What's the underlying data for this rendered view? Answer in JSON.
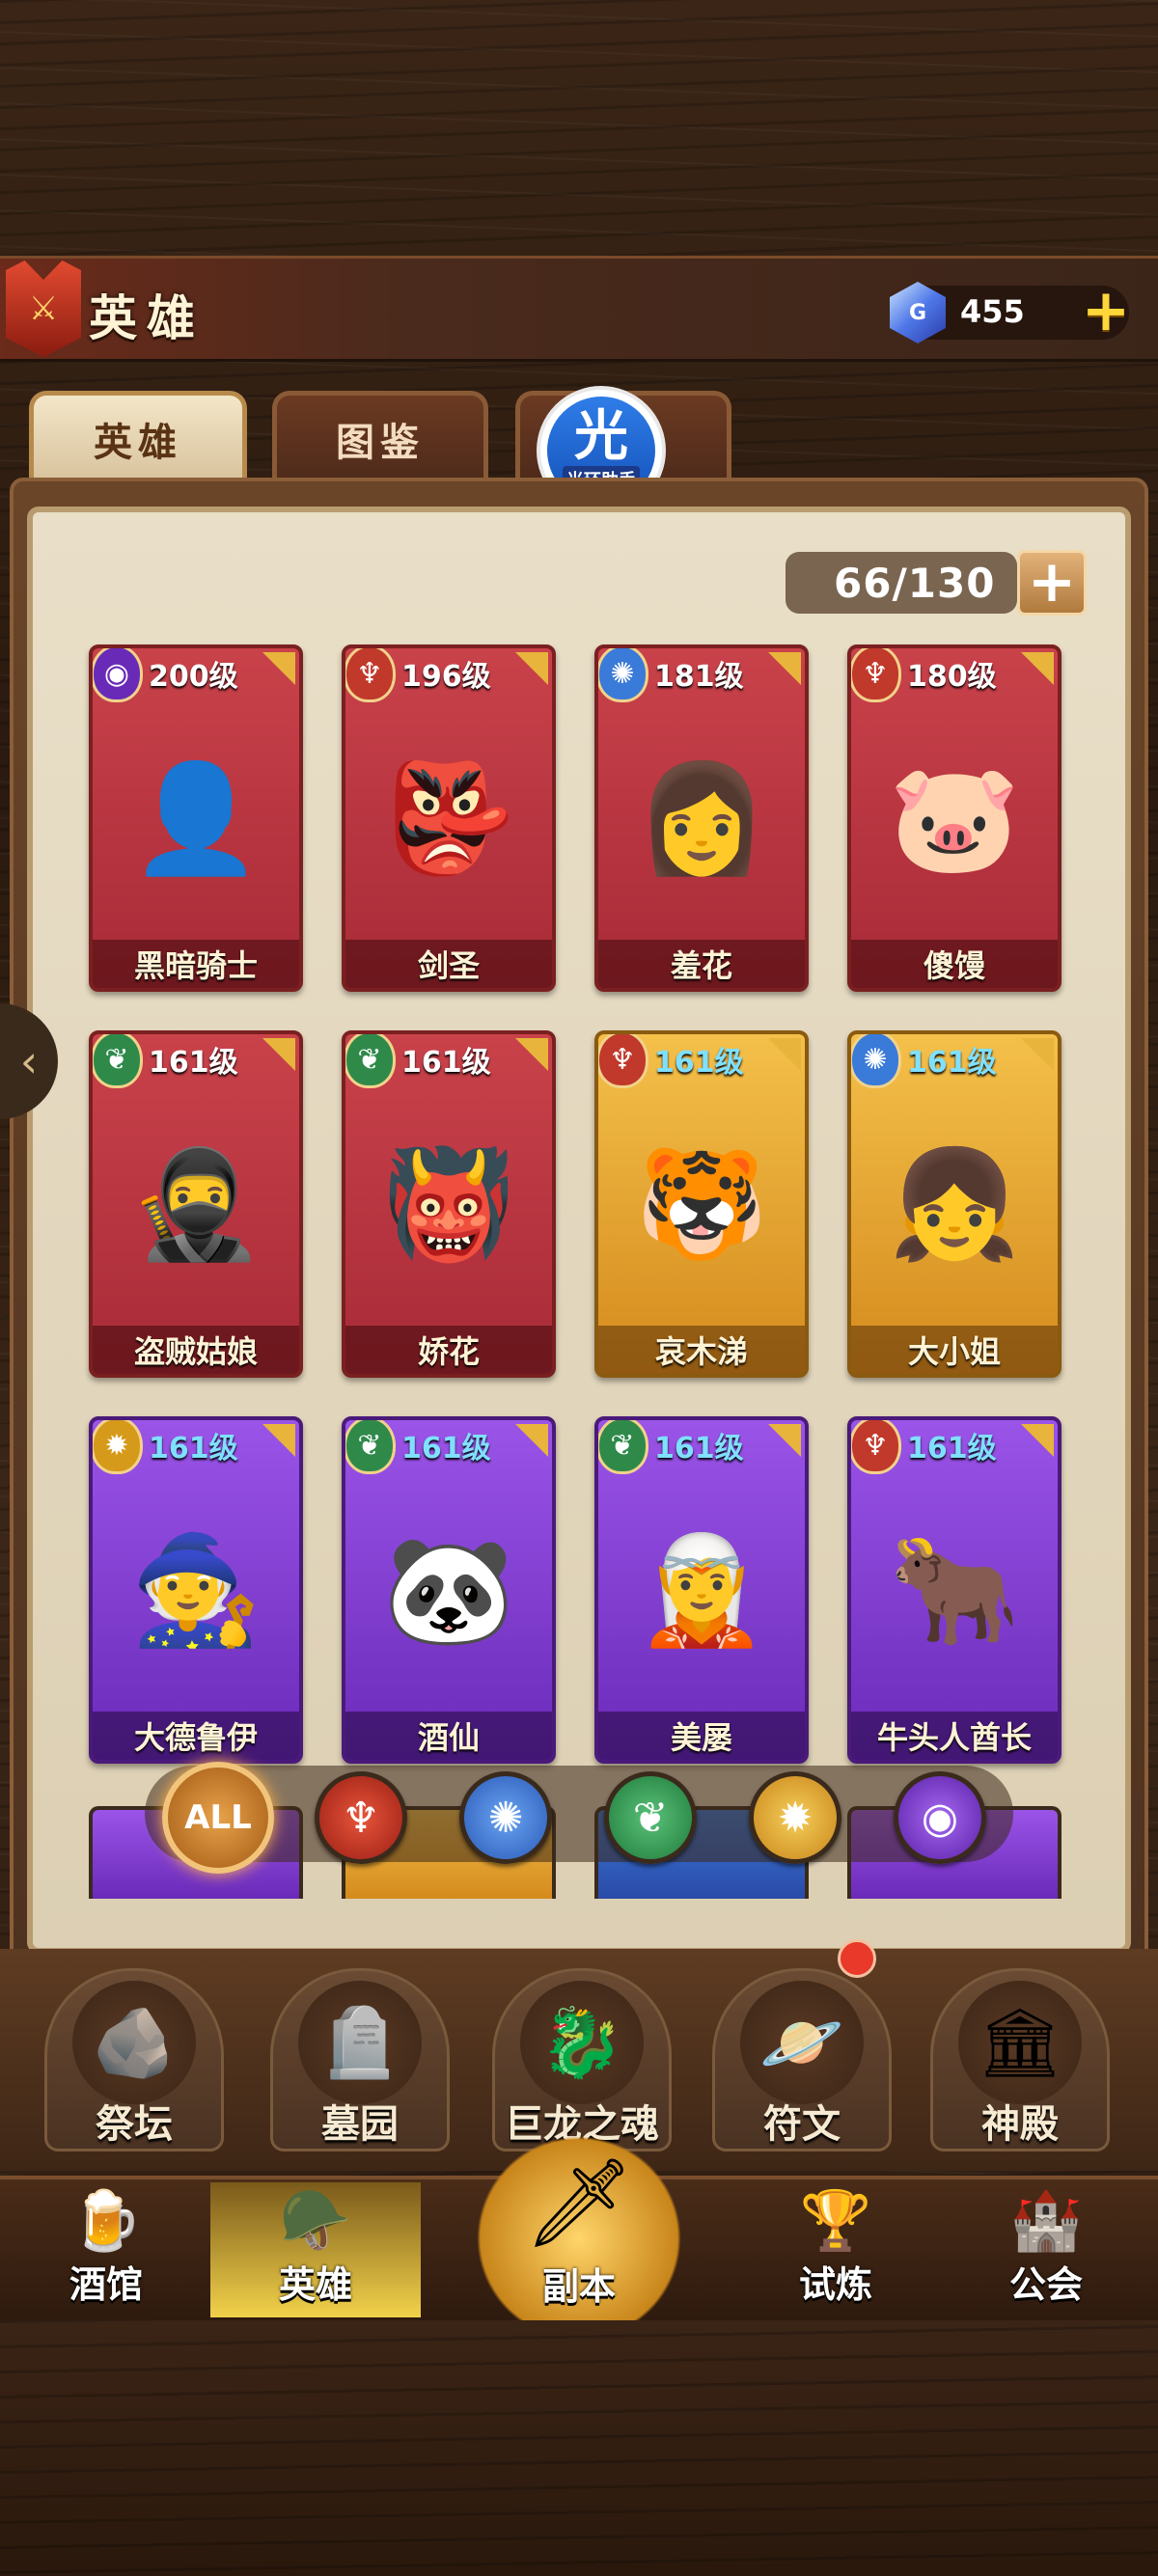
{
  "header": {
    "title": "英雄",
    "emblem_icon": "helmet-emblem-icon",
    "gems": "455",
    "gem_icon_letter": "G"
  },
  "tabs": [
    {
      "label": "英雄",
      "active": true
    },
    {
      "label": "图鉴",
      "active": false
    }
  ],
  "helper_badge": {
    "char": "光",
    "label": "光环助手"
  },
  "hero_count": "66/130",
  "heroes": [
    {
      "level": "200级",
      "name": "黑暗骑士",
      "rarity": "red",
      "faction": "void",
      "icon": "👤"
    },
    {
      "level": "196级",
      "name": "剑圣",
      "rarity": "red",
      "faction": "fire",
      "icon": "👺"
    },
    {
      "level": "181级",
      "name": "羞花",
      "rarity": "red",
      "faction": "frost",
      "icon": "👩"
    },
    {
      "level": "180级",
      "name": "傻馒",
      "rarity": "red",
      "faction": "fire",
      "icon": "🐷"
    },
    {
      "level": "161级",
      "name": "盗贼姑娘",
      "rarity": "red",
      "faction": "nature",
      "icon": "🥷"
    },
    {
      "level": "161级",
      "name": "娇花",
      "rarity": "red",
      "faction": "nature",
      "icon": "👹"
    },
    {
      "level": "161级",
      "name": "哀木涕",
      "rarity": "gold",
      "faction": "fire",
      "icon": "🐯"
    },
    {
      "level": "161级",
      "name": "大小姐",
      "rarity": "gold",
      "faction": "frost",
      "icon": "👧"
    },
    {
      "level": "161级",
      "name": "大德鲁伊",
      "rarity": "purple",
      "faction": "light",
      "icon": "🧙"
    },
    {
      "level": "161级",
      "name": "酒仙",
      "rarity": "purple",
      "faction": "nature",
      "icon": "🐼"
    },
    {
      "level": "161级",
      "name": "美屡",
      "rarity": "purple",
      "faction": "nature",
      "icon": "🧝"
    },
    {
      "level": "161级",
      "name": "牛头人酋长",
      "rarity": "purple",
      "faction": "fire",
      "icon": "🐂"
    }
  ],
  "filters": {
    "all_label": "ALL",
    "icons": [
      "fire-faction-icon",
      "frost-faction-icon",
      "nature-faction-icon",
      "light-faction-icon",
      "void-faction-icon"
    ]
  },
  "menu": [
    {
      "label": "祭坛",
      "icon": "🪨"
    },
    {
      "label": "墓园",
      "icon": "🪦"
    },
    {
      "label": "巨龙之魂",
      "icon": "🐉"
    },
    {
      "label": "符文",
      "icon": "🪐"
    },
    {
      "label": "神殿",
      "icon": "🏛"
    }
  ],
  "nav": [
    {
      "label": "酒馆",
      "icon": "🍺"
    },
    {
      "label": "英雄",
      "icon": "🪖"
    },
    {
      "label": "副本",
      "icon": "🗡"
    },
    {
      "label": "试炼",
      "icon": "🏆"
    },
    {
      "label": "公会",
      "icon": "🏰"
    }
  ],
  "colors": {
    "accent_gold": "#ffd73a",
    "card_red": "#c9424a",
    "card_gold": "#f4c04a",
    "card_purple": "#9a54e8",
    "notification": "#e8392a"
  }
}
